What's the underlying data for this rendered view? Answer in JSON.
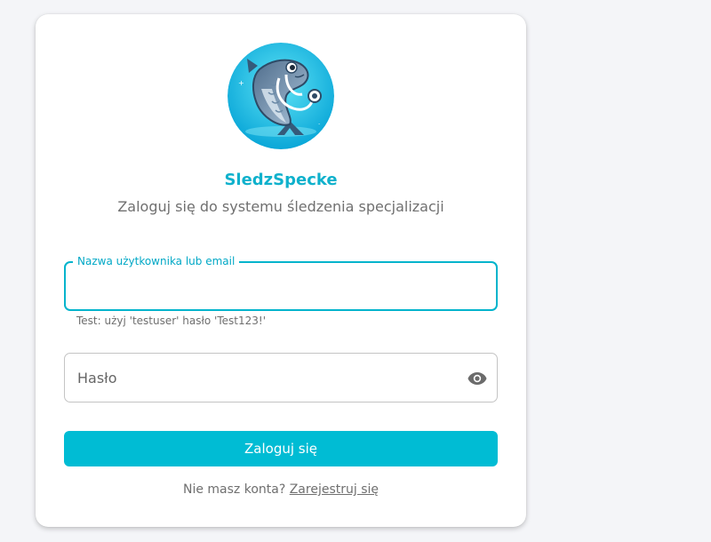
{
  "app": {
    "title": "SledzSpecke",
    "subtitle": "Zaloguj się do systemu śledzenia specjalizacji",
    "logo_icon": "fish-doctor-logo",
    "accent_color": "#00bcd4"
  },
  "login_form": {
    "username_label": "Nazwa użytkownika lub email",
    "username_value": "",
    "username_helper": "Test: użyj 'testuser' hasło 'Test123!'",
    "password_placeholder": "Hasło",
    "password_value": "",
    "password_toggle_icon": "eye-icon",
    "submit_label": "Zaloguj się"
  },
  "register": {
    "prompt": "Nie masz konta?",
    "link_label": "Zarejestruj się"
  }
}
